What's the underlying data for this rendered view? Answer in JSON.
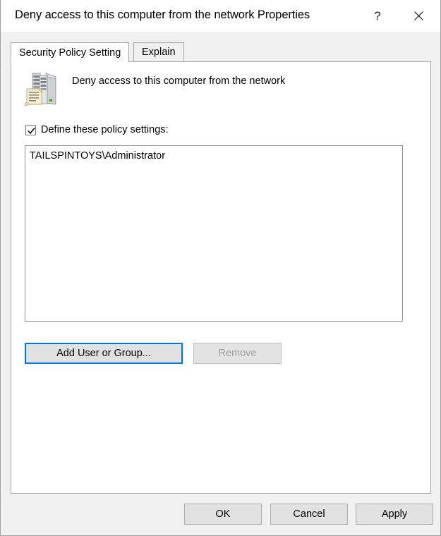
{
  "window": {
    "title": "Deny access to this computer from the network Properties",
    "help_button": "?",
    "close_button": "✕"
  },
  "tabs": [
    {
      "label": "Security Policy Setting",
      "active": true
    },
    {
      "label": "Explain",
      "active": false
    }
  ],
  "policy": {
    "icon": "server-policy-icon",
    "name": "Deny access to this computer from the network"
  },
  "define_checkbox": {
    "label": "Define these policy settings:",
    "checked": true
  },
  "list": {
    "items": [
      "TAILSPINTOYS\\Administrator"
    ]
  },
  "buttons": {
    "add_user_or_group": "Add User or Group...",
    "remove": "Remove",
    "ok": "OK",
    "cancel": "Cancel",
    "apply": "Apply"
  },
  "colors": {
    "focus_border": "#0078d7",
    "button_face": "#e1e1e1",
    "window_background": "#f0f0f0",
    "panel_background": "#ffffff",
    "disabled_text": "#a0a0a0"
  }
}
